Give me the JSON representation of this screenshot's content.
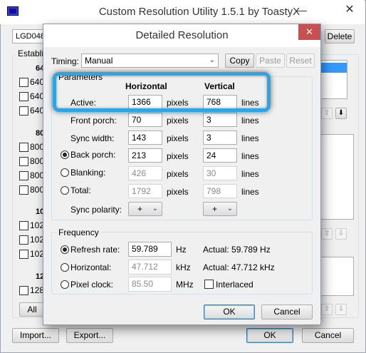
{
  "main": {
    "title": "Custom Resolution Utility 1.5.1 by ToastyX",
    "minimize": "—",
    "close": "✕",
    "monitor_select": "LGD048",
    "delete_label": "Delete",
    "established_label": "Establi",
    "group1_header": "64",
    "group1_items": [
      "640",
      "640",
      "640"
    ],
    "group2_header": "80",
    "group2_items": [
      "800",
      "800",
      "800",
      "800"
    ],
    "group3_header": "10",
    "group3_items": [
      "102",
      "102",
      "102"
    ],
    "group4_header": "12",
    "group4_items": [
      "128"
    ],
    "all_label": "All",
    "import_label": "Import...",
    "export_label": "Export...",
    "ok_label": "OK",
    "cancel_label": "Cancel"
  },
  "dialog": {
    "title": "Detailed Resolution",
    "close": "✕",
    "timing_label": "Timing:",
    "timing_value": "Manual",
    "copy_label": "Copy",
    "paste_label": "Paste",
    "reset_label": "Reset",
    "parameters_legend": "Parameters",
    "horizontal_header": "Horizontal",
    "vertical_header": "Vertical",
    "rows": [
      {
        "label": "Active:",
        "h": "1366",
        "h_unit": "pixels",
        "v": "768",
        "v_unit": "lines"
      },
      {
        "label": "Front porch:",
        "h": "70",
        "h_unit": "pixels",
        "v": "3",
        "v_unit": "lines"
      },
      {
        "label": "Sync width:",
        "h": "143",
        "h_unit": "pixels",
        "v": "3",
        "v_unit": "lines"
      },
      {
        "label": "Back porch:",
        "h": "213",
        "h_unit": "pixels",
        "v": "24",
        "v_unit": "lines"
      },
      {
        "label": "Blanking:",
        "h": "426",
        "h_unit": "pixels",
        "v": "30",
        "v_unit": "lines"
      },
      {
        "label": "Total:",
        "h": "1792",
        "h_unit": "pixels",
        "v": "798",
        "v_unit": "lines"
      }
    ],
    "sync_polarity_label": "Sync polarity:",
    "sync_h": "+",
    "sync_v": "+",
    "frequency_legend": "Frequency",
    "refresh_label": "Refresh rate:",
    "refresh_value": "59.789",
    "refresh_unit": "Hz",
    "refresh_actual": "Actual: 59.789 Hz",
    "horizontal_label": "Horizontal:",
    "horizontal_value": "47.712",
    "horizontal_unit": "kHz",
    "horizontal_actual": "Actual: 47.712 kHz",
    "pixel_clock_label": "Pixel clock:",
    "pixel_clock_value": "85.50",
    "pixel_clock_unit": "MHz",
    "interlaced_label": "Interlaced",
    "ok_label": "OK",
    "cancel_label": "Cancel"
  },
  "colors": {
    "highlight": "#2aa6e8",
    "dialog_close": "#c75050",
    "selection": "#3399ff"
  }
}
